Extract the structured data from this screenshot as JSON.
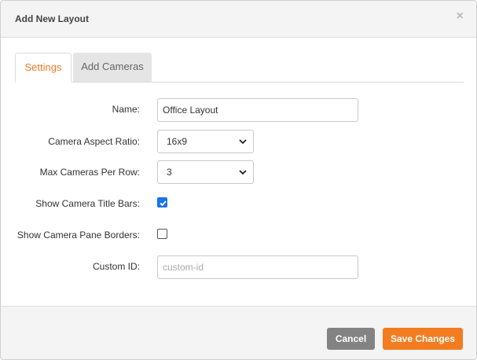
{
  "dialog": {
    "title": "Add New Layout",
    "close_symbol": "×"
  },
  "tabs": [
    {
      "label": "Settings",
      "active": true
    },
    {
      "label": "Add Cameras",
      "active": false
    }
  ],
  "form": {
    "name": {
      "label": "Name:",
      "value": "Office Layout"
    },
    "aspect_ratio": {
      "label": "Camera Aspect Ratio:",
      "value": "16x9"
    },
    "max_per_row": {
      "label": "Max Cameras Per Row:",
      "value": "3"
    },
    "title_bars": {
      "label": "Show Camera Title Bars:",
      "checked": true
    },
    "pane_borders": {
      "label": "Show Camera Pane Borders:",
      "checked": false
    },
    "custom_id": {
      "label": "Custom ID:",
      "value": "",
      "placeholder": "custom-id"
    }
  },
  "footer": {
    "cancel_label": "Cancel",
    "save_label": "Save Changes"
  },
  "colors": {
    "accent": "#f37c21",
    "cancel": "#838383",
    "checkbox": "#1a73e8"
  },
  "icons": {
    "close": "close-icon",
    "dropdown": "chevron-down-icon",
    "check": "checkmark-icon"
  }
}
